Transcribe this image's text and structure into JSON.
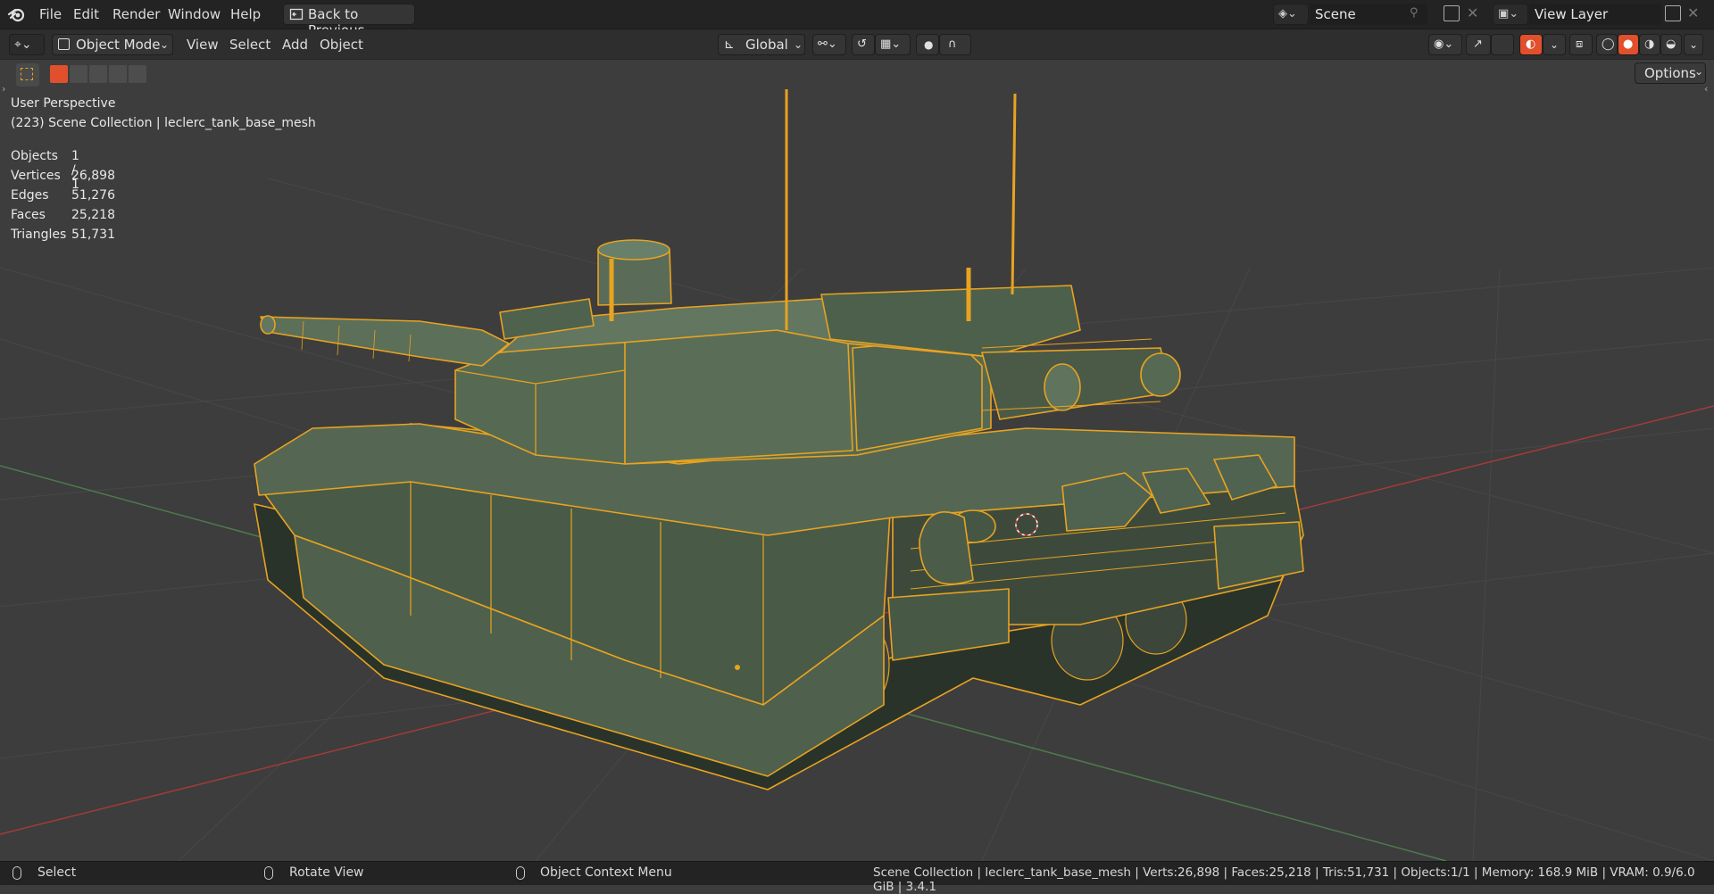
{
  "topbar": {
    "menus": [
      "File",
      "Edit",
      "Render",
      "Window",
      "Help"
    ],
    "back_button": "Back to Previous",
    "scene_label": "Scene",
    "view_layer_label": "View Layer"
  },
  "header": {
    "mode": "Object Mode",
    "menus": [
      "View",
      "Select",
      "Add",
      "Object"
    ],
    "transform_orientation": "Global",
    "options_label": "Options"
  },
  "viewport": {
    "perspective": "User Perspective",
    "collection_line": "(223) Scene Collection | leclerc_tank_base_mesh",
    "stats": [
      {
        "label": "Objects",
        "value": "1 / 1"
      },
      {
        "label": "Vertices",
        "value": "26,898"
      },
      {
        "label": "Edges",
        "value": "51,276"
      },
      {
        "label": "Faces",
        "value": "25,218"
      },
      {
        "label": "Triangles",
        "value": "51,731"
      }
    ]
  },
  "statusbar": {
    "select": "Select",
    "rotate": "Rotate View",
    "context": "Object Context Menu",
    "info": "Scene Collection | leclerc_tank_base_mesh | Verts:26,898 | Faces:25,218 | Tris:51,731 | Objects:1/1 | Memory: 168.9 MiB | VRAM: 0.9/6.0 GiB | 3.4.1"
  },
  "colors": {
    "accent_orange": "#e8a320",
    "mesh_fill": "#4d5e4a",
    "active_red": "#e0502c",
    "grid_red": "#a63a3a",
    "grid_green": "#4e7a4e"
  },
  "icons": [
    "blender-logo-icon",
    "editor-type-icon",
    "object-mode-icon",
    "transform-orientation-icon",
    "snap-icon",
    "proportional-icon",
    "visibility-icon",
    "gizmo-icon",
    "overlay-icon",
    "xray-icon",
    "wireframe-shading-icon",
    "solid-shading-icon",
    "material-shading-icon",
    "rendered-shading-icon",
    "select-box-icon",
    "mouse-left-icon",
    "mouse-middle-icon",
    "mouse-right-icon"
  ]
}
